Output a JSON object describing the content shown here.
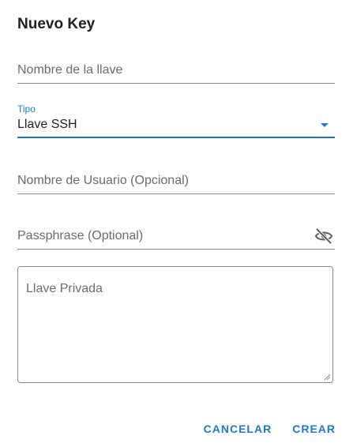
{
  "dialog": {
    "title": "Nuevo Key"
  },
  "fields": {
    "name": {
      "placeholder": "Nombre de la llave",
      "value": ""
    },
    "tipo": {
      "label": "Tipo",
      "selected": "Llave SSH"
    },
    "username": {
      "placeholder": "Nombre de Usuario (Opcional)",
      "value": ""
    },
    "passphrase": {
      "placeholder": "Passphrase (Optional)",
      "value": "",
      "visibility_icon": "eye-off-icon"
    },
    "private_key": {
      "placeholder": "Llave Privada",
      "value": ""
    }
  },
  "actions": {
    "cancel_label": "CANCELAR",
    "create_label": "CREAR"
  },
  "colors": {
    "accent": "#1e78c8",
    "text": "#212121",
    "muted": "#6b6b6b"
  }
}
